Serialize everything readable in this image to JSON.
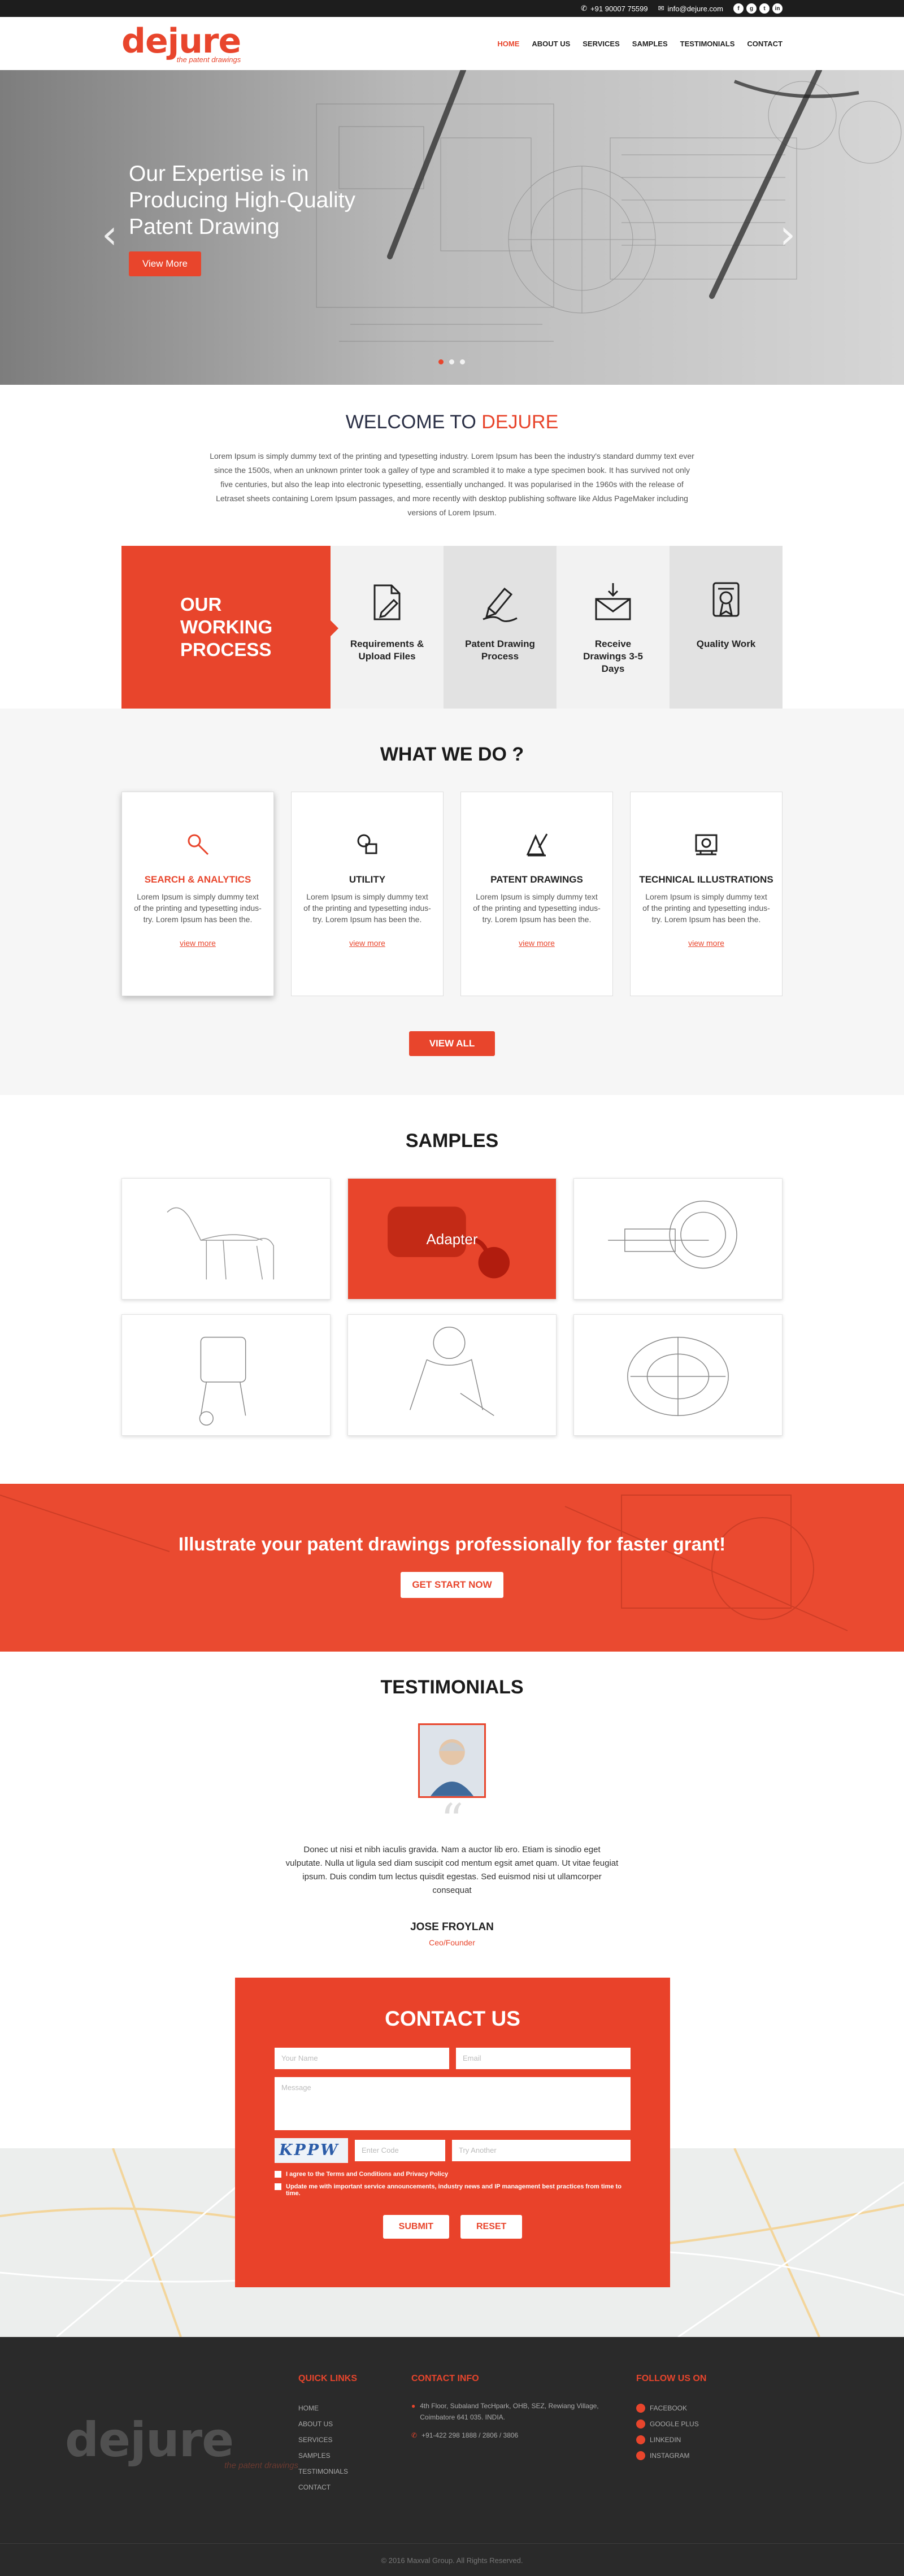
{
  "topbar": {
    "phone": "+91 90007 75599",
    "email": "info@dejure.com",
    "social": [
      "f",
      "g",
      "t",
      "in"
    ]
  },
  "logo": {
    "main": "dejure",
    "sub": "the patent drawings"
  },
  "nav": [
    "HOME",
    "ABOUT US",
    "SERVICES",
    "SAMPLES",
    "TESTIMONIALS",
    "CONTACT"
  ],
  "hero": {
    "title": "Our Expertise is in Producing High-Quality Patent Drawing",
    "button": "View More",
    "prev": "‹",
    "next": "›"
  },
  "welcome": {
    "title_a": "WELCOME TO",
    "title_b": "DEJURE",
    "text": "Lorem Ipsum is simply dummy text of the printing and typesetting industry. Lorem Ipsum has been the industry's standard dummy text ever since the 1500s, when an unknown printer took a galley of type and scrambled it to make a type specimen book. It has survived not only five centuries, but also the leap into electronic typesetting, essentially unchanged. It was popularised in the 1960s with the release of Letraset sheets containing Lorem Ipsum passages, and more recently with desktop publishing software like Aldus PageMaker including versions of Lorem Ipsum."
  },
  "process": {
    "title": "OUR WORKING PROCESS",
    "steps": [
      {
        "label": "Requirements & Upload Files",
        "icon": "document-edit-icon"
      },
      {
        "label": "Patent Drawing Process",
        "icon": "pen-drawing-icon"
      },
      {
        "label": "Receive Drawings 3-5 Days",
        "icon": "mail-download-icon"
      },
      {
        "label": "Quality Work",
        "icon": "certificate-icon"
      }
    ]
  },
  "whatwedo": {
    "title": "WHAT WE DO ?",
    "cards": [
      {
        "title": "SEARCH & ANALYTICS",
        "text": "Lorem Ipsum is simply dummy text of the printing and typesetting indus-try. Lorem Ipsum has been the.",
        "link": "view more",
        "icon": "search-icon"
      },
      {
        "title": "UTILITY",
        "text": "Lorem Ipsum is simply dummy text of the printing and typesetting indus-try. Lorem Ipsum has been the.",
        "link": "view more",
        "icon": "shapes-icon"
      },
      {
        "title": "PATENT DRAWINGS",
        "text": "Lorem Ipsum is simply dummy text of the printing and typesetting indus-try. Lorem Ipsum has been the.",
        "link": "view more",
        "icon": "drafting-tools-icon"
      },
      {
        "title": "TECHNICAL ILLUSTRATIONS",
        "text": "Lorem Ipsum is simply dummy text of the printing and typesetting indus-try. Lorem Ipsum has been the.",
        "link": "view more",
        "icon": "blueprint-icon"
      }
    ],
    "button": "VIEW ALL"
  },
  "samples": {
    "title": "SAMPLES",
    "highlight_caption": "Adapter"
  },
  "cta": {
    "title": "Illustrate your patent drawings professionally for faster grant!",
    "button": "GET START NOW"
  },
  "testimonials": {
    "title": "TESTIMONIALS",
    "quote_mark": "“",
    "text": "Donec ut nisi et nibh iaculis gravida. Nam a auctor lib ero. Etiam is sinodio eget vulputate. Nulla ut ligula sed diam suscipit cod mentum egsit amet quam. Ut vitae feugiat ipsum. Duis condim tum lectus quisdit egestas. Sed euismod nisi ut ullamcorper consequat",
    "name": "JOSE FROYLAN",
    "role": "Ceo/Founder"
  },
  "contact": {
    "title": "CONTACT US",
    "name_ph": "Your Name",
    "email_ph": "Email",
    "message_ph": "Message",
    "captcha": "KPPW",
    "code_ph": "Enter Code",
    "another": "Try Another",
    "check1": "I agree to the Terms and Conditions and Privacy Policy",
    "check2": "Update me with important service announcements, industry news and IP management best practices from time to time.",
    "submit": "SUBMIT",
    "reset": "RESET"
  },
  "footer": {
    "quick_title": "QUICK LINKS",
    "quick": [
      "HOME",
      "ABOUT US",
      "SERVICES",
      "SAMPLES",
      "TESTIMONIALS",
      "CONTACT"
    ],
    "contact_title": "CONTACT INFO",
    "address": "4th Floor, Subaland TecHpark, OHB, SEZ, Rewiang Village, Coimbatore 641 035. INDIA.",
    "phone": "+91-422 298 1888 / 2806 / 3806",
    "follow_title": "FOLLOW US ON",
    "follow": [
      "FACEBOOK",
      "GOOGLE PLUS",
      "LINKEDIN",
      "INSTAGRAM"
    ],
    "copyright": "© 2016 Maxval Group. All Rights Reserved."
  }
}
